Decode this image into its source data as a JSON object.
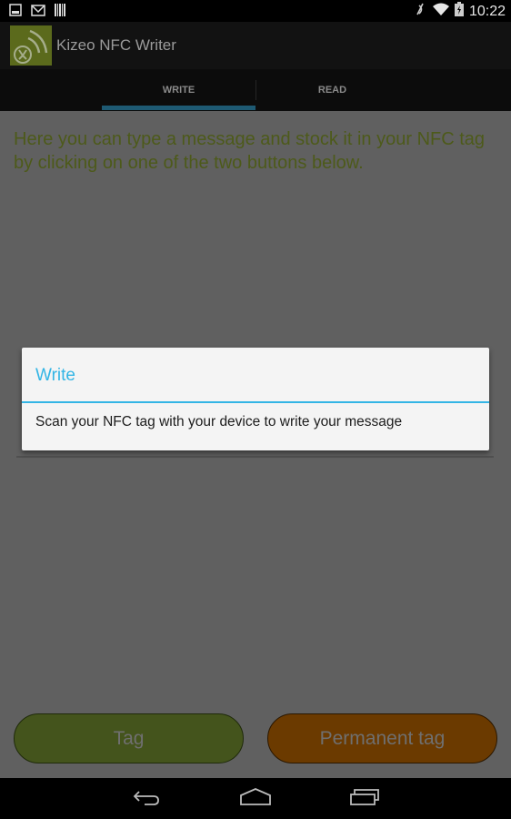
{
  "status_bar": {
    "left_icons": [
      "image-notification-icon",
      "gmail-notification-icon",
      "barcode-notification-icon"
    ],
    "right_icons": [
      "nfc-muted-icon",
      "wifi-icon",
      "battery-charging-icon"
    ],
    "time": "10:22"
  },
  "action_bar": {
    "app_icon": "kizeo-nfc-logo",
    "title": "Kizeo NFC Writer"
  },
  "tabs": [
    {
      "label": "WRITE",
      "selected": true
    },
    {
      "label": "READ",
      "selected": false
    }
  ],
  "main": {
    "intro_text": "Here you can type a message and stock it in your NFC tag by clicking on one of the two buttons below."
  },
  "dialog": {
    "title": "Write",
    "message": "Scan your NFC tag with your device to write your message"
  },
  "buttons": {
    "tag_label": "Tag",
    "permanent_tag_label": "Permanent tag"
  },
  "nav_bar": {
    "icons": [
      "back-icon",
      "home-icon",
      "recent-apps-icon"
    ]
  },
  "colors": {
    "accent": "#33b5e5",
    "tag_button": "#44541c",
    "permanent_button": "#6b3a00",
    "intro_text": "#4d5a1a"
  }
}
